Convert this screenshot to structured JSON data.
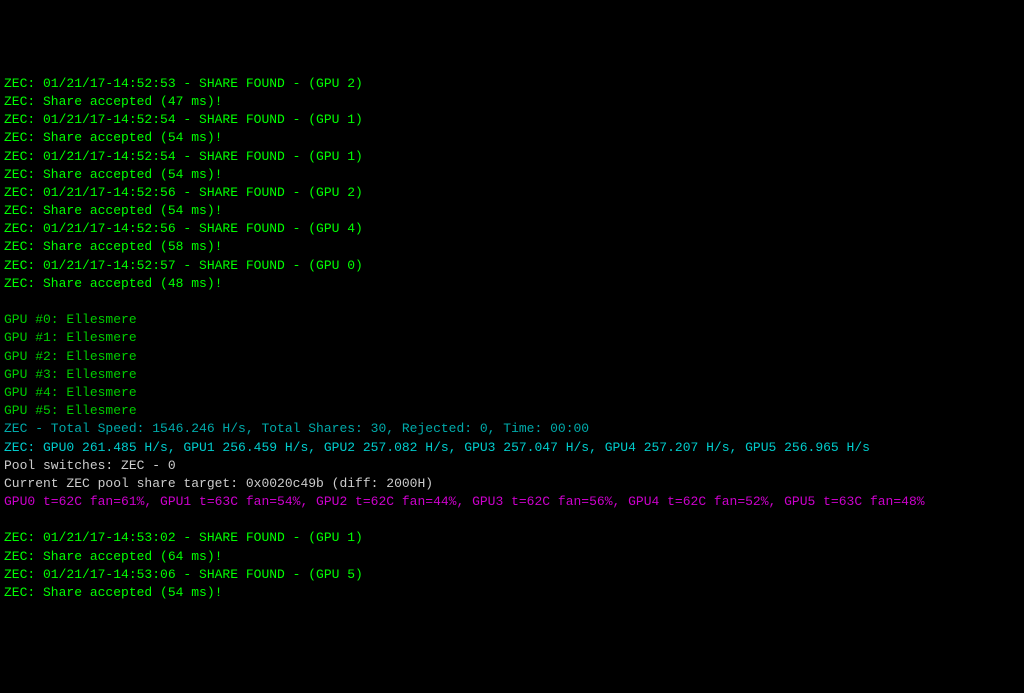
{
  "shares_top": [
    {
      "found": "ZEC: 01/21/17-14:52:53 - SHARE FOUND - (GPU 2)",
      "accepted": "ZEC: Share accepted (47 ms)!"
    },
    {
      "found": "ZEC: 01/21/17-14:52:54 - SHARE FOUND - (GPU 1)",
      "accepted": "ZEC: Share accepted (54 ms)!"
    },
    {
      "found": "ZEC: 01/21/17-14:52:54 - SHARE FOUND - (GPU 1)",
      "accepted": "ZEC: Share accepted (54 ms)!"
    },
    {
      "found": "ZEC: 01/21/17-14:52:56 - SHARE FOUND - (GPU 2)",
      "accepted": "ZEC: Share accepted (54 ms)!"
    },
    {
      "found": "ZEC: 01/21/17-14:52:56 - SHARE FOUND - (GPU 4)",
      "accepted": "ZEC: Share accepted (58 ms)!"
    },
    {
      "found": "ZEC: 01/21/17-14:52:57 - SHARE FOUND - (GPU 0)",
      "accepted": "ZEC: Share accepted (48 ms)!"
    }
  ],
  "gpus": [
    "GPU #0: Ellesmere",
    "GPU #1: Ellesmere",
    "GPU #2: Ellesmere",
    "GPU #3: Ellesmere",
    "GPU #4: Ellesmere",
    "GPU #5: Ellesmere"
  ],
  "summary": {
    "total": "ZEC - Total Speed: 1546.246 H/s, Total Shares: 30, Rejected: 0, Time: 00:00",
    "hashrates": "ZEC: GPU0 261.485 H/s, GPU1 256.459 H/s, GPU2 257.082 H/s, GPU3 257.047 H/s, GPU4 257.207 H/s, GPU5 256.965 H/s",
    "pool_switches": "Pool switches: ZEC - 0",
    "share_target": "Current ZEC pool share target: 0x0020c49b (diff: 2000H)",
    "temps": "GPU0 t=62C fan=61%, GPU1 t=63C fan=54%, GPU2 t=62C fan=44%, GPU3 t=62C fan=56%, GPU4 t=62C fan=52%, GPU5 t=63C fan=48%"
  },
  "shares_bottom": [
    {
      "found": "ZEC: 01/21/17-14:53:02 - SHARE FOUND - (GPU 1)",
      "accepted": "ZEC: Share accepted (64 ms)!"
    },
    {
      "found": "ZEC: 01/21/17-14:53:06 - SHARE FOUND - (GPU 5)",
      "accepted": "ZEC: Share accepted (54 ms)!"
    }
  ]
}
